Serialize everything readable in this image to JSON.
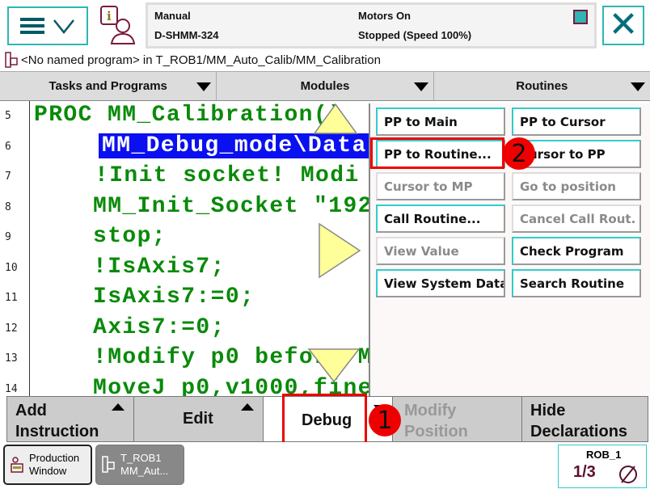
{
  "header": {
    "mode": "Manual",
    "system_name": "D-SHMM-324",
    "motors": "Motors On",
    "state": "Stopped (Speed 100%)"
  },
  "path": "<No named program> in T_ROB1/MM_Auto_Calib/MM_Calibration",
  "tabs": [
    {
      "label": "Tasks and Programs"
    },
    {
      "label": "Modules"
    },
    {
      "label": "Routines"
    }
  ],
  "code": [
    {
      "line": "5",
      "text": "PROC MM_Calibration()"
    },
    {
      "line": "6",
      "text": "MM_Debug_mode\\Data"
    },
    {
      "line": "7",
      "text": "!Init socket! Modi"
    },
    {
      "line": "8",
      "text": "MM_Init_Socket \"192"
    },
    {
      "line": "9",
      "text": "stop;"
    },
    {
      "line": "10",
      "text": "!IsAxis7;"
    },
    {
      "line": "11",
      "text": "IsAxis7:=0;"
    },
    {
      "line": "12",
      "text": "Axis7:=0;"
    },
    {
      "line": "13",
      "text": "!Modify p0 before M"
    },
    {
      "line": "14",
      "text": "MoveJ p0,v1000,fine"
    }
  ],
  "debug_menu": [
    {
      "label": "PP to Main",
      "enabled": true
    },
    {
      "label": "PP to Cursor",
      "enabled": true
    },
    {
      "label": "PP to Routine...",
      "enabled": true
    },
    {
      "label": "Cursor to PP",
      "enabled": true
    },
    {
      "label": "Cursor to MP",
      "enabled": false
    },
    {
      "label": "Go to position",
      "enabled": false
    },
    {
      "label": "Call Routine...",
      "enabled": true
    },
    {
      "label": "Cancel Call Rout.",
      "enabled": false
    },
    {
      "label": "View Value",
      "enabled": false
    },
    {
      "label": "Check Program",
      "enabled": true
    },
    {
      "label": "View System Data",
      "enabled": true
    },
    {
      "label": "Search Routine",
      "enabled": true
    }
  ],
  "toolbar": {
    "add_instruction_1": "Add",
    "add_instruction_2": "Instruction",
    "edit": "Edit",
    "debug": "Debug",
    "modify_1": "Modify",
    "modify_2": "Position",
    "hide_1": "Hide",
    "hide_2": "Declarations"
  },
  "taskbar": {
    "production_1": "Production",
    "production_2": "Window",
    "task_1": "T_ROB1",
    "task_2": "MM_Aut...",
    "robot": "ROB_1",
    "fraction": "1/3"
  },
  "annotations": {
    "step1": "1",
    "step2": "2"
  },
  "colors": {
    "accent": "#2fb5b5",
    "code": "#0a8a0a",
    "selection": "#0a10f0",
    "highlight": "#ee0000"
  }
}
